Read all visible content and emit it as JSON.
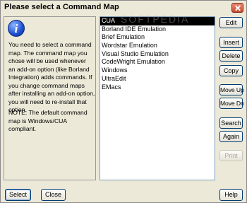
{
  "window": {
    "title": "Please select a Command Map"
  },
  "info": {
    "message": "You need to select a command\nmap.  The command map you\nchose will be used whenever\nan add-on option (like Borland\nIntegration) adds commands.  If\nyou change command maps\nafter installing an add-on option,\nyou will need to re-install that\noption.",
    "note": "NOTE: The default command\nmap is Windows/CUA\ncompliant."
  },
  "watermark": "SOFTPEDIA",
  "command_maps": [
    {
      "label": "CUA",
      "selected": true
    },
    {
      "label": "Borland IDE Emulation",
      "selected": false
    },
    {
      "label": "Brief Emulation",
      "selected": false
    },
    {
      "label": "Wordstar Emulation",
      "selected": false
    },
    {
      "label": "Visual Studio Emulation",
      "selected": false
    },
    {
      "label": "CodeWright Emulation",
      "selected": false
    },
    {
      "label": "Windows",
      "selected": false
    },
    {
      "label": "UltraEdit",
      "selected": false
    },
    {
      "label": "EMacs",
      "selected": false
    }
  ],
  "buttons": {
    "edit": "Edit",
    "insert": "Insert",
    "delete": "Delete",
    "copy": "Copy",
    "move_up": "Move Up",
    "move_dn": "Move Dn",
    "search": "Search",
    "again": "Again",
    "print": "Print",
    "select": "Select",
    "close": "Close",
    "help": "Help"
  },
  "icons": {
    "info": "info-icon",
    "close": "close-icon"
  }
}
